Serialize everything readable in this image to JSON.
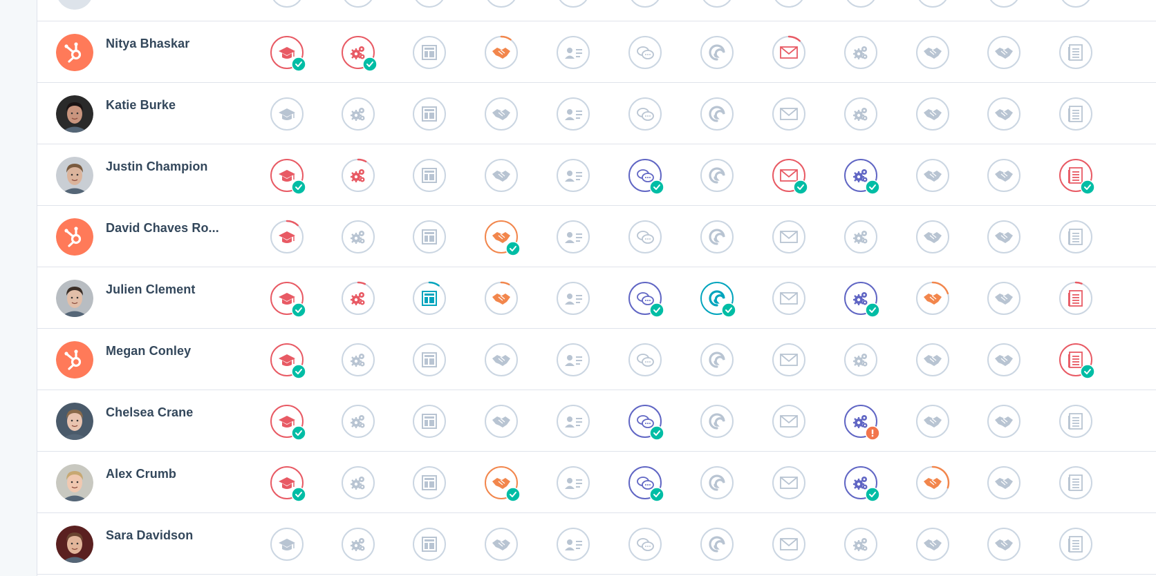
{
  "colors": {
    "inactive": "#cbd6e2",
    "inactive_icon": "#b8c4d2",
    "red": "#e85a64",
    "orange": "#f2864c",
    "blue": "#6066c4",
    "teal": "#00a4bd",
    "check": "#00bda5",
    "warning": "#f2754c",
    "hubspot_orange": "#ff7a59"
  },
  "courses": [
    {
      "key": "inbound",
      "icon": "graduation-cap-icon"
    },
    {
      "key": "inbound-sales",
      "icon": "gears-icon"
    },
    {
      "key": "contextual-marketing",
      "icon": "layout-icon"
    },
    {
      "key": "sales-enablement",
      "icon": "handshake-icon"
    },
    {
      "key": "contact-management",
      "icon": "contact-card-icon"
    },
    {
      "key": "conversations",
      "icon": "chat-bubbles-icon"
    },
    {
      "key": "growth-driven-design",
      "icon": "spiral-icon"
    },
    {
      "key": "email-marketing",
      "icon": "envelope-icon"
    },
    {
      "key": "marketing-software",
      "icon": "gears-icon"
    },
    {
      "key": "sales-software",
      "icon": "handshake-icon"
    },
    {
      "key": "sales-management",
      "icon": "handshake-icon"
    },
    {
      "key": "content-marketing",
      "icon": "document-icon"
    }
  ],
  "rows": [
    {
      "name": "",
      "avatar": "gray",
      "cells": [
        {
          "s": "none"
        },
        {
          "s": "none"
        },
        {
          "s": "none"
        },
        {
          "s": "none"
        },
        {
          "s": "none"
        },
        {
          "s": "none"
        },
        {
          "s": "none"
        },
        {
          "s": "none"
        },
        {
          "s": "none"
        },
        {
          "s": "none"
        },
        {
          "s": "none"
        },
        {
          "s": "none"
        }
      ]
    },
    {
      "name": "Nitya Bhaskar",
      "avatar": "hubspot",
      "cells": [
        {
          "s": "done",
          "c": "red"
        },
        {
          "s": "done",
          "c": "red"
        },
        {
          "s": "none"
        },
        {
          "s": "progress",
          "c": "orange",
          "p": 0.1
        },
        {
          "s": "none"
        },
        {
          "s": "none"
        },
        {
          "s": "none"
        },
        {
          "s": "progress",
          "c": "red",
          "p": 0.12
        },
        {
          "s": "none"
        },
        {
          "s": "none"
        },
        {
          "s": "none"
        },
        {
          "s": "none"
        }
      ]
    },
    {
      "name": "Katie Burke",
      "avatar": "photo1",
      "cells": [
        {
          "s": "none"
        },
        {
          "s": "none"
        },
        {
          "s": "none"
        },
        {
          "s": "none"
        },
        {
          "s": "none"
        },
        {
          "s": "none"
        },
        {
          "s": "none"
        },
        {
          "s": "none"
        },
        {
          "s": "none"
        },
        {
          "s": "none"
        },
        {
          "s": "none"
        },
        {
          "s": "none"
        }
      ]
    },
    {
      "name": "Justin Champion",
      "avatar": "photo2",
      "cells": [
        {
          "s": "done",
          "c": "red"
        },
        {
          "s": "progress",
          "c": "red",
          "p": 0.08
        },
        {
          "s": "none"
        },
        {
          "s": "none"
        },
        {
          "s": "none"
        },
        {
          "s": "done",
          "c": "blue"
        },
        {
          "s": "none"
        },
        {
          "s": "done",
          "c": "red"
        },
        {
          "s": "done",
          "c": "blue"
        },
        {
          "s": "none"
        },
        {
          "s": "none"
        },
        {
          "s": "done",
          "c": "red"
        }
      ]
    },
    {
      "name": "David Chaves Ro...",
      "avatar": "hubspot",
      "cells": [
        {
          "s": "progress",
          "c": "red",
          "p": 0.12
        },
        {
          "s": "none"
        },
        {
          "s": "none"
        },
        {
          "s": "done",
          "c": "orange"
        },
        {
          "s": "none"
        },
        {
          "s": "none"
        },
        {
          "s": "none"
        },
        {
          "s": "none"
        },
        {
          "s": "none"
        },
        {
          "s": "none"
        },
        {
          "s": "none"
        },
        {
          "s": "none"
        }
      ]
    },
    {
      "name": "Julien Clement",
      "avatar": "photo3",
      "cells": [
        {
          "s": "done",
          "c": "red"
        },
        {
          "s": "progress",
          "c": "red",
          "p": 0.07
        },
        {
          "s": "progress",
          "c": "teal",
          "p": 0.1
        },
        {
          "s": "progress",
          "c": "orange",
          "p": 0.08
        },
        {
          "s": "none"
        },
        {
          "s": "done",
          "c": "blue"
        },
        {
          "s": "done",
          "c": "teal"
        },
        {
          "s": "none"
        },
        {
          "s": "done",
          "c": "blue"
        },
        {
          "s": "progress",
          "c": "orange",
          "p": 0.2
        },
        {
          "s": "none"
        },
        {
          "s": "progress",
          "c": "red",
          "p": 0.06
        }
      ]
    },
    {
      "name": "Megan Conley",
      "avatar": "hubspot",
      "cells": [
        {
          "s": "done",
          "c": "red"
        },
        {
          "s": "none"
        },
        {
          "s": "none"
        },
        {
          "s": "none"
        },
        {
          "s": "none"
        },
        {
          "s": "none"
        },
        {
          "s": "none"
        },
        {
          "s": "none"
        },
        {
          "s": "none"
        },
        {
          "s": "none"
        },
        {
          "s": "none"
        },
        {
          "s": "done",
          "c": "red"
        }
      ]
    },
    {
      "name": "Chelsea Crane",
      "avatar": "photo4",
      "cells": [
        {
          "s": "done",
          "c": "red"
        },
        {
          "s": "none"
        },
        {
          "s": "none"
        },
        {
          "s": "none"
        },
        {
          "s": "none"
        },
        {
          "s": "done",
          "c": "blue"
        },
        {
          "s": "none"
        },
        {
          "s": "none"
        },
        {
          "s": "warning",
          "c": "blue"
        },
        {
          "s": "none"
        },
        {
          "s": "none"
        },
        {
          "s": "none"
        }
      ]
    },
    {
      "name": "Alex Crumb",
      "avatar": "photo5",
      "cells": [
        {
          "s": "done",
          "c": "red"
        },
        {
          "s": "none"
        },
        {
          "s": "none"
        },
        {
          "s": "done",
          "c": "orange"
        },
        {
          "s": "none"
        },
        {
          "s": "done",
          "c": "blue"
        },
        {
          "s": "none"
        },
        {
          "s": "none"
        },
        {
          "s": "done",
          "c": "blue"
        },
        {
          "s": "progress",
          "c": "orange",
          "p": 0.3
        },
        {
          "s": "none"
        },
        {
          "s": "none"
        }
      ]
    },
    {
      "name": "Sara Davidson",
      "avatar": "photo6",
      "cells": [
        {
          "s": "none"
        },
        {
          "s": "none"
        },
        {
          "s": "none"
        },
        {
          "s": "none"
        },
        {
          "s": "none"
        },
        {
          "s": "none"
        },
        {
          "s": "none"
        },
        {
          "s": "none"
        },
        {
          "s": "none"
        },
        {
          "s": "none"
        },
        {
          "s": "none"
        },
        {
          "s": "none"
        }
      ]
    }
  ]
}
